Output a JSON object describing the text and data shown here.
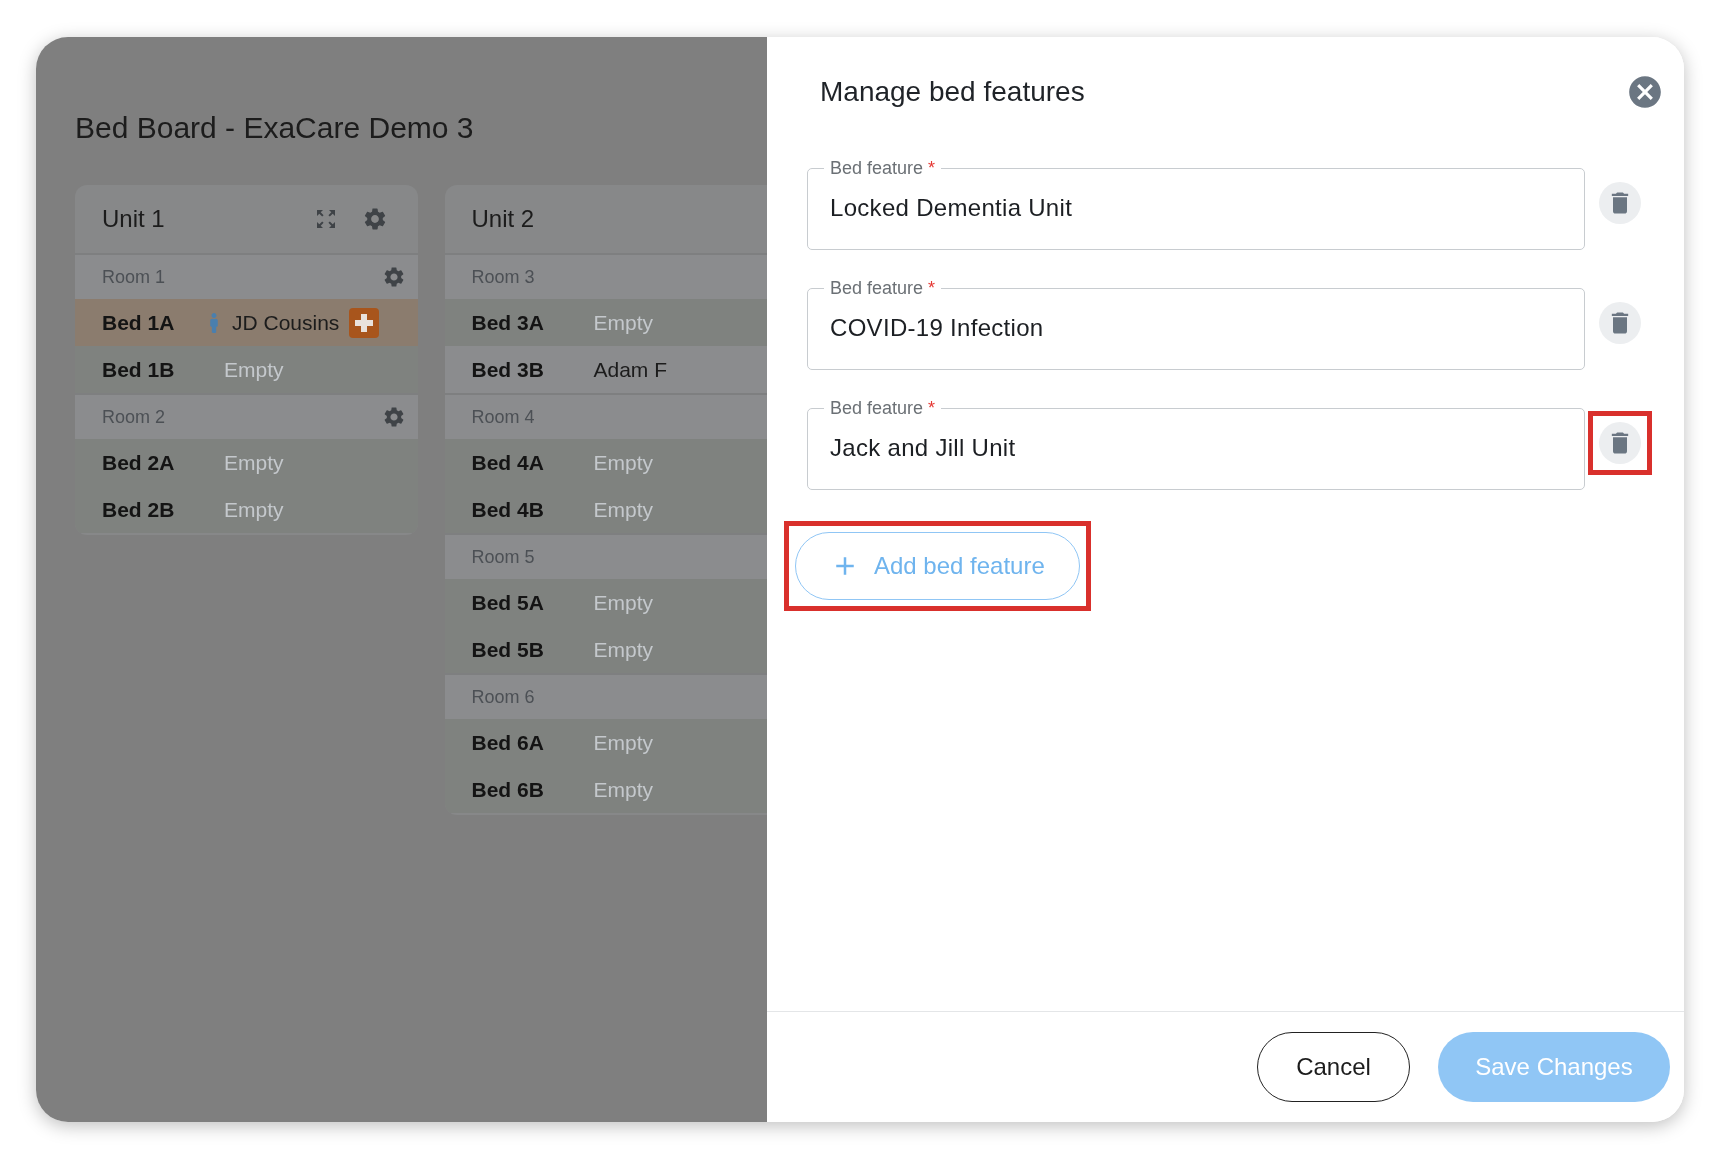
{
  "board": {
    "title": "Bed Board - ExaCare Demo 3",
    "units": [
      {
        "name": "Unit 1",
        "tools_shown": true,
        "rooms": [
          {
            "name": "Room 1",
            "beds": [
              {
                "name": "Bed 1A",
                "occupant": "JD Cousins",
                "kind": "alert"
              },
              {
                "name": "Bed 1B",
                "occupant": "Empty",
                "kind": "empty"
              }
            ]
          },
          {
            "name": "Room 2",
            "beds": [
              {
                "name": "Bed 2A",
                "occupant": "Empty",
                "kind": "empty"
              },
              {
                "name": "Bed 2B",
                "occupant": "Empty",
                "kind": "empty"
              }
            ]
          }
        ]
      },
      {
        "name": "Unit 2",
        "tools_shown": false,
        "rooms": [
          {
            "name": "Room 3",
            "beds": [
              {
                "name": "Bed 3A",
                "occupant": "Empty",
                "kind": "empty"
              },
              {
                "name": "Bed 3B",
                "occupant": "Adam F",
                "kind": "occupied"
              }
            ]
          },
          {
            "name": "Room 4",
            "beds": [
              {
                "name": "Bed 4A",
                "occupant": "Empty",
                "kind": "empty"
              },
              {
                "name": "Bed 4B",
                "occupant": "Empty",
                "kind": "empty"
              }
            ]
          },
          {
            "name": "Room 5",
            "beds": [
              {
                "name": "Bed 5A",
                "occupant": "Empty",
                "kind": "empty"
              },
              {
                "name": "Bed 5B",
                "occupant": "Empty",
                "kind": "empty"
              }
            ]
          },
          {
            "name": "Room 6",
            "beds": [
              {
                "name": "Bed 6A",
                "occupant": "Empty",
                "kind": "empty"
              },
              {
                "name": "Bed 6B",
                "occupant": "Empty",
                "kind": "empty"
              }
            ]
          }
        ]
      }
    ]
  },
  "drawer": {
    "title": "Manage bed features",
    "features": [
      {
        "label": "Bed feature",
        "required_mark": "*",
        "value": "Locked Dementia Unit",
        "highlighted": false
      },
      {
        "label": "Bed feature",
        "required_mark": "*",
        "value": "COVID-19 Infection",
        "highlighted": false
      },
      {
        "label": "Bed feature",
        "required_mark": "*",
        "value": "Jack and Jill Unit",
        "highlighted": true
      }
    ],
    "add_button": {
      "label": "Add bed feature",
      "highlighted": true
    },
    "buttons": {
      "cancel": "Cancel",
      "save": "Save Changes"
    }
  }
}
